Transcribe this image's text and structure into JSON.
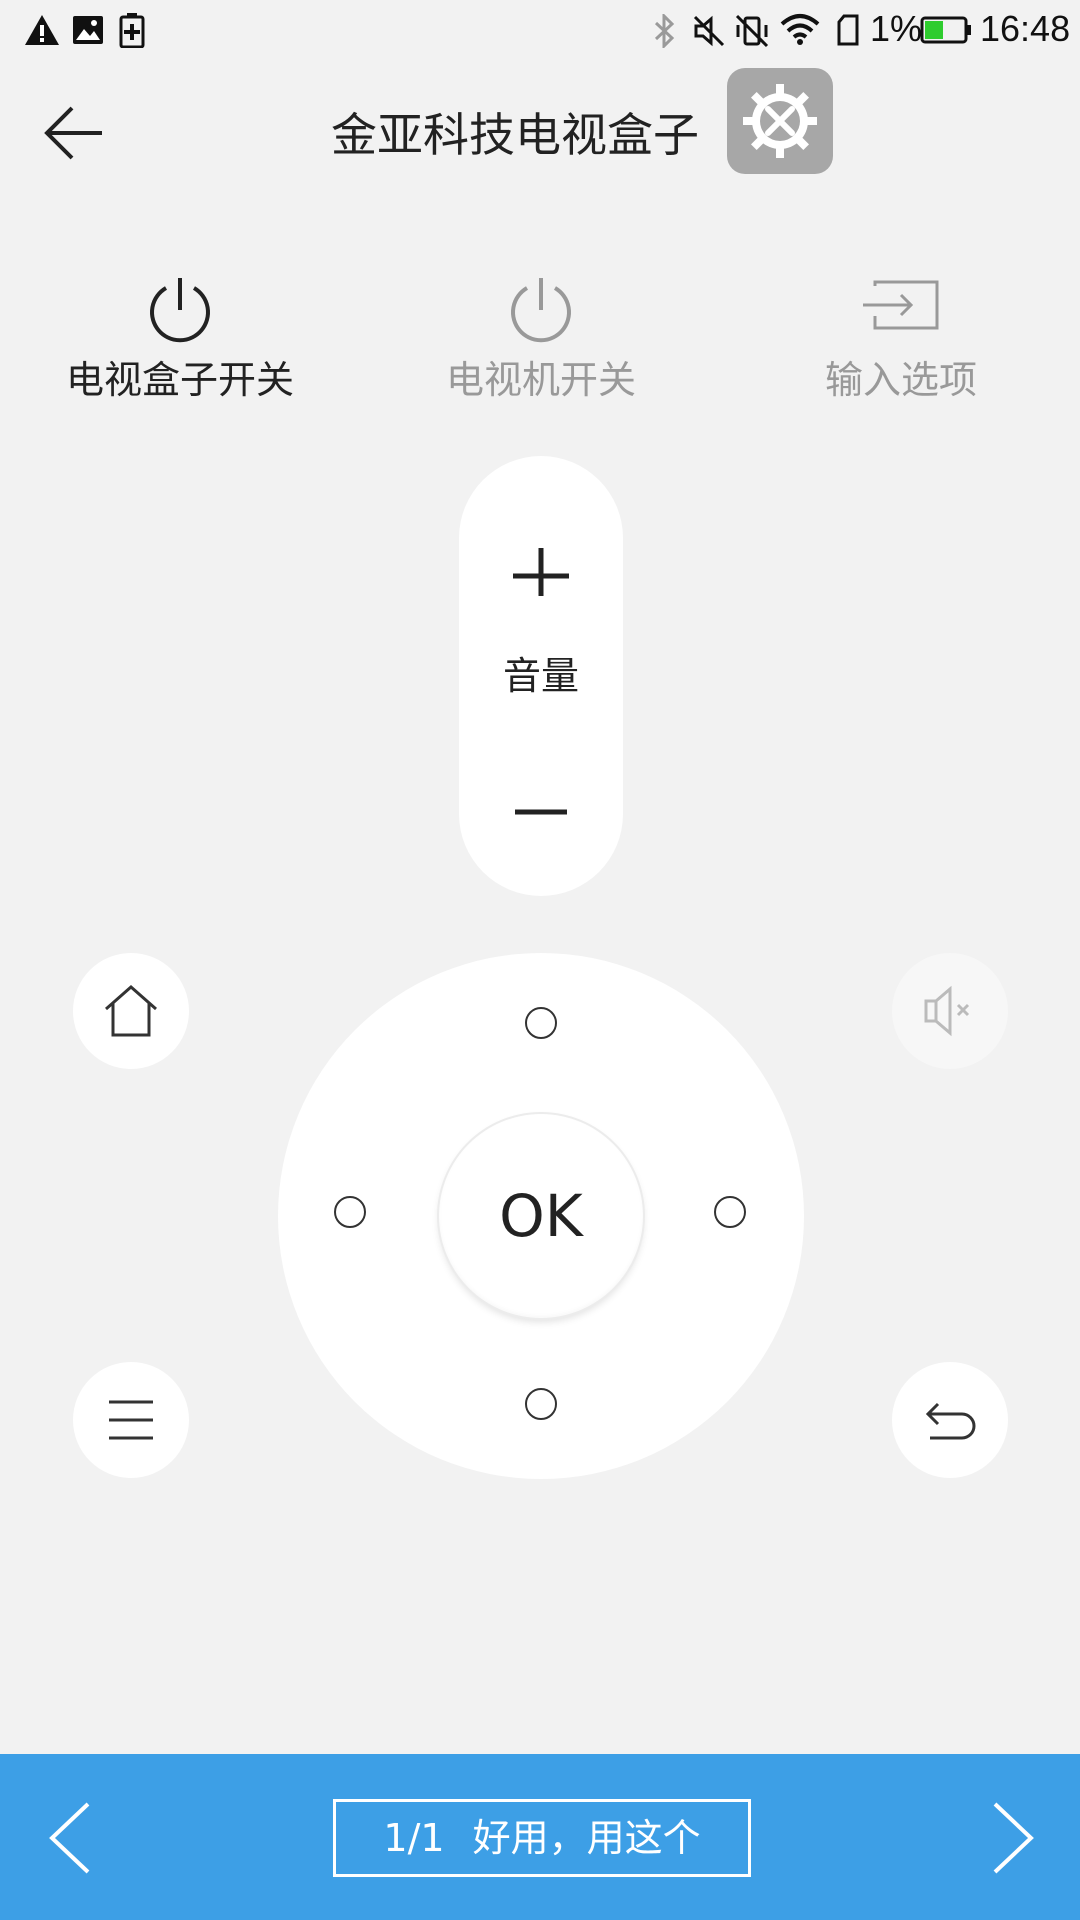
{
  "status_bar": {
    "battery": "1%",
    "time": "16:48",
    "battery_color": "#2ecc2e",
    "icons": [
      "warning-icon",
      "image-icon",
      "battery-saver-icon",
      "bluetooth-icon",
      "mute-icon",
      "vibrate-off-icon",
      "wifi-icon",
      "sim-icon",
      "battery-icon"
    ]
  },
  "header": {
    "title": "金亚科技电视盒子",
    "back_icon": "arrow-left-icon",
    "settings_icon": "gear-tools-icon"
  },
  "top_actions": [
    {
      "label": "电视盒子开关",
      "icon": "power-icon",
      "active": true
    },
    {
      "label": "电视机开关",
      "icon": "power-icon",
      "active": false
    },
    {
      "label": "输入选项",
      "icon": "input-source-icon",
      "active": false
    }
  ],
  "volume": {
    "label": "音量",
    "up_icon": "plus-icon",
    "down_icon": "minus-icon"
  },
  "dpad": {
    "ok_label": "OK"
  },
  "side_buttons": {
    "home_icon": "home-icon",
    "mute_icon": "speaker-mute-icon",
    "menu_icon": "menu-icon",
    "back_icon": "return-icon"
  },
  "bottom_bar": {
    "page": "1/1",
    "confirm_label": "好用，用这个",
    "background": "#3d9fe6"
  },
  "colors": {
    "background": "#f2f2f2",
    "settings_bg": "#a7a7a7",
    "inactive_text": "#999999"
  }
}
